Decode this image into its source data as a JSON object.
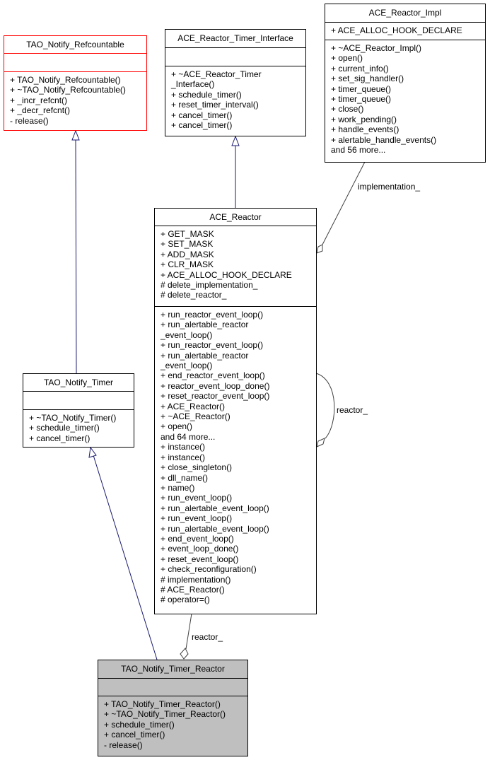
{
  "diagram": {
    "type": "UML class collaboration diagram",
    "classes": {
      "refcountable": {
        "name": "TAO_Notify_Refcountable",
        "attributes": [],
        "methods": [
          "+ TAO_Notify_Refcountable()",
          "+ ~TAO_Notify_Refcountable()",
          "+ _incr_refcnt()",
          "+ _decr_refcnt()",
          "- release()"
        ]
      },
      "timer_interface": {
        "name": "ACE_Reactor_Timer_Interface",
        "attributes": [],
        "methods": [
          "+ ~ACE_Reactor_Timer",
          "_Interface()",
          "+ schedule_timer()",
          "+ reset_timer_interval()",
          "+ cancel_timer()",
          "+ cancel_timer()"
        ]
      },
      "reactor_impl": {
        "name": "ACE_Reactor_Impl",
        "attributes": [
          "+ ACE_ALLOC_HOOK_DECLARE"
        ],
        "methods": [
          "+ ~ACE_Reactor_Impl()",
          "+ open()",
          "+ current_info()",
          "+ set_sig_handler()",
          "+ timer_queue()",
          "+ timer_queue()",
          "+ close()",
          "+ work_pending()",
          "+ handle_events()",
          "+ alertable_handle_events()",
          "and 56 more..."
        ]
      },
      "reactor": {
        "name": "ACE_Reactor",
        "attributes": [
          "+ GET_MASK",
          "+ SET_MASK",
          "+ ADD_MASK",
          "+ CLR_MASK",
          "+ ACE_ALLOC_HOOK_DECLARE",
          "# delete_implementation_",
          "# delete_reactor_"
        ],
        "methods": [
          "+ run_reactor_event_loop()",
          "+ run_alertable_reactor",
          "_event_loop()",
          "+ run_reactor_event_loop()",
          "+ run_alertable_reactor",
          "_event_loop()",
          "+ end_reactor_event_loop()",
          "+ reactor_event_loop_done()",
          "+ reset_reactor_event_loop()",
          "+ ACE_Reactor()",
          "+ ~ACE_Reactor()",
          "+ open()",
          "and 64 more...",
          "+ instance()",
          "+ instance()",
          "+ close_singleton()",
          "+ dll_name()",
          "+ name()",
          "+ run_event_loop()",
          "+ run_alertable_event_loop()",
          "+ run_event_loop()",
          "+ run_alertable_event_loop()",
          "+ end_event_loop()",
          "+ event_loop_done()",
          "+ reset_event_loop()",
          "+ check_reconfiguration()",
          "# implementation()",
          "# ACE_Reactor()",
          "# operator=()"
        ]
      },
      "notify_timer": {
        "name": "TAO_Notify_Timer",
        "attributes": [],
        "methods": [
          "+ ~TAO_Notify_Timer()",
          "+ schedule_timer()",
          "+ cancel_timer()"
        ]
      },
      "timer_reactor": {
        "name": "TAO_Notify_Timer_Reactor",
        "attributes": [],
        "methods": [
          "+ TAO_Notify_Timer_Reactor()",
          "+ ~TAO_Notify_Timer_Reactor()",
          "+ schedule_timer()",
          "+ cancel_timer()",
          "- release()"
        ]
      }
    },
    "edge_labels": {
      "implementation": "implementation_",
      "reactor_self": "reactor_",
      "reactor_member": "reactor_"
    },
    "colors": {
      "inheritance_edge": "#191970",
      "association_edge": "#404040",
      "focus_fill": "#bfbfbf",
      "highlight_border": "#ff0000"
    }
  }
}
